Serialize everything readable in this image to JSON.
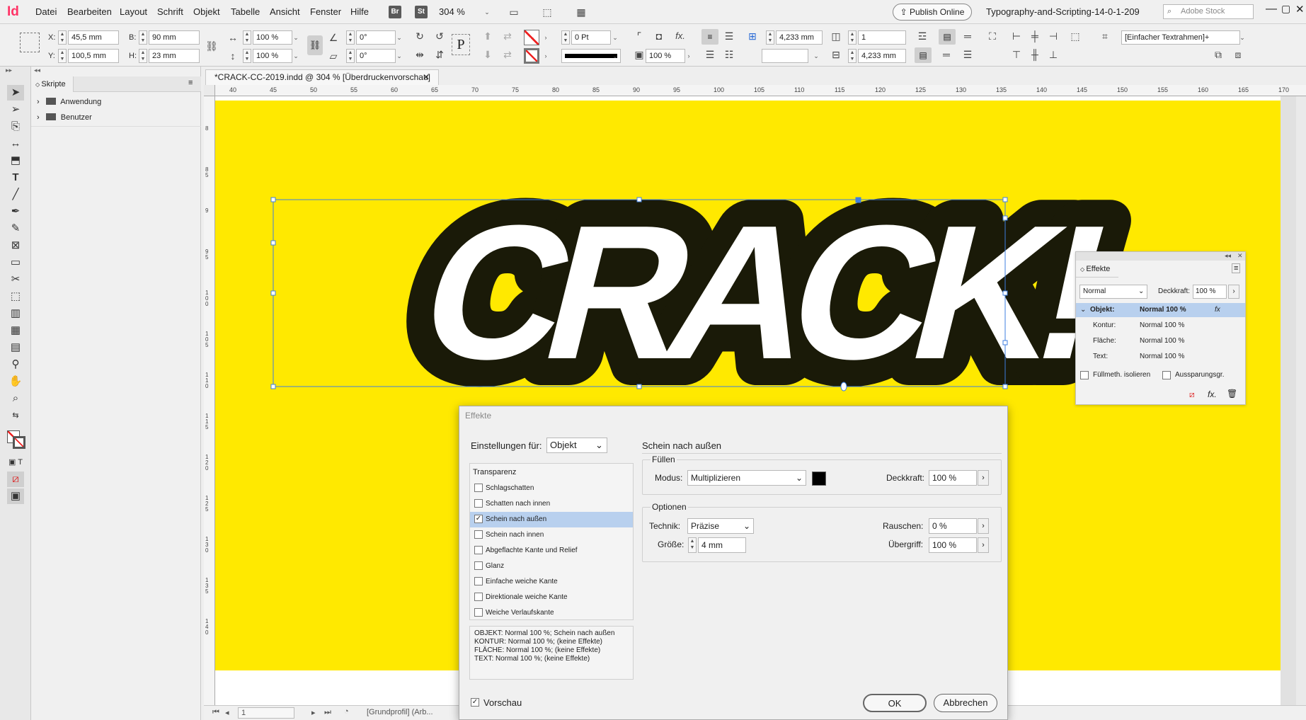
{
  "app": {
    "logo": "Id"
  },
  "menu": [
    "Datei",
    "Bearbeiten",
    "Layout",
    "Schrift",
    "Objekt",
    "Tabelle",
    "Ansicht",
    "Fenster",
    "Hilfe"
  ],
  "menubar": {
    "br": "Br",
    "st": "St",
    "zoom": "304 %",
    "publish": "Publish Online",
    "workspace": "Typography-and-Scripting-14-0-1-209",
    "search_placeholder": "Adobe Stock"
  },
  "control": {
    "x_label": "X:",
    "x": "45,5 mm",
    "y_label": "Y:",
    "y": "100,5 mm",
    "w_label": "B:",
    "w": "90 mm",
    "h_label": "H:",
    "h": "23 mm",
    "scale_x": "100 %",
    "scale_y": "100 %",
    "rotate": "0°",
    "shear": "0°",
    "stroke_weight": "0 Pt",
    "opacity": "100 %",
    "frame_style": "[Einfacher Textrahmen]+",
    "gutter1": "4,233 mm",
    "gutter2": "4,233 mm",
    "columns": "1",
    "type_p": "P"
  },
  "scripts_panel": {
    "title": "Skripte",
    "items": [
      "Anwendung",
      "Benutzer"
    ]
  },
  "doc_tab": {
    "title": "*CRACK-CC-2019.indd @ 304 % [Überdruckenvorschau]",
    "close": "✕"
  },
  "ruler": {
    "h_ticks": [
      "40",
      "45",
      "50",
      "55",
      "60",
      "65",
      "70",
      "75",
      "80",
      "85",
      "90",
      "95",
      "100",
      "105",
      "110",
      "115",
      "120",
      "125",
      "130",
      "135",
      "140",
      "145",
      "150",
      "155",
      "160",
      "165",
      "170"
    ],
    "v_ticks": [
      "8",
      "8 5",
      "9",
      "9 5",
      "1 0 0",
      "1 0 5",
      "1 1 0",
      "1 1 5",
      "1 2 0",
      "1 2 5",
      "1 3 0",
      "1 3 5",
      "1 4 0"
    ]
  },
  "artwork": {
    "text": "CRACK!",
    "bg": "#ffe900",
    "outline": "#1a1a08",
    "fill": "#ffffff"
  },
  "status": {
    "page": "1",
    "profile": "[Grundprofil] (Arb..."
  },
  "effects_panel": {
    "title": "Effekte",
    "mode": "Normal",
    "opacity_label": "Deckkraft:",
    "opacity": "100 %",
    "rows": [
      {
        "k": "Objekt:",
        "v": "Normal 100 %"
      },
      {
        "k": "Kontur:",
        "v": "Normal 100 %"
      },
      {
        "k": "Fläche:",
        "v": "Normal 100 %"
      },
      {
        "k": "Text:",
        "v": "Normal 100 %"
      }
    ],
    "isolate": "Füllmeth. isolieren",
    "knockout": "Aussparungsgr.",
    "fx": "fx"
  },
  "dialog": {
    "title": "Effekte",
    "settings_for_label": "Einstellungen für:",
    "settings_for": "Objekt",
    "transparency_header": "Transparenz",
    "effects": [
      {
        "label": "Schlagschatten",
        "checked": false
      },
      {
        "label": "Schatten nach innen",
        "checked": false
      },
      {
        "label": "Schein nach außen",
        "checked": true
      },
      {
        "label": "Schein nach innen",
        "checked": false
      },
      {
        "label": "Abgeflachte Kante und Relief",
        "checked": false
      },
      {
        "label": "Glanz",
        "checked": false
      },
      {
        "label": "Einfache weiche Kante",
        "checked": false
      },
      {
        "label": "Direktionale weiche Kante",
        "checked": false
      },
      {
        "label": "Weiche Verlaufskante",
        "checked": false
      }
    ],
    "summary": [
      "OBJEKT: Normal 100 %; Schein nach außen",
      "KONTUR: Normal 100 %; (keine Effekte)",
      "FLÄCHE: Normal 100 %; (keine Effekte)",
      "TEXT: Normal 100 %; (keine Effekte)"
    ],
    "section_title": "Schein nach außen",
    "fill_group": "Füllen",
    "mode_label": "Modus:",
    "mode": "Multiplizieren",
    "opacity_label": "Deckkraft:",
    "opacity": "100 %",
    "color": "#000000",
    "options_group": "Optionen",
    "technique_label": "Technik:",
    "technique": "Präzise",
    "noise_label": "Rauschen:",
    "noise": "0 %",
    "size_label": "Größe:",
    "size": "4 mm",
    "spread_label": "Übergriff:",
    "spread": "100 %",
    "preview_label": "Vorschau",
    "ok": "OK",
    "cancel": "Abbrechen"
  }
}
